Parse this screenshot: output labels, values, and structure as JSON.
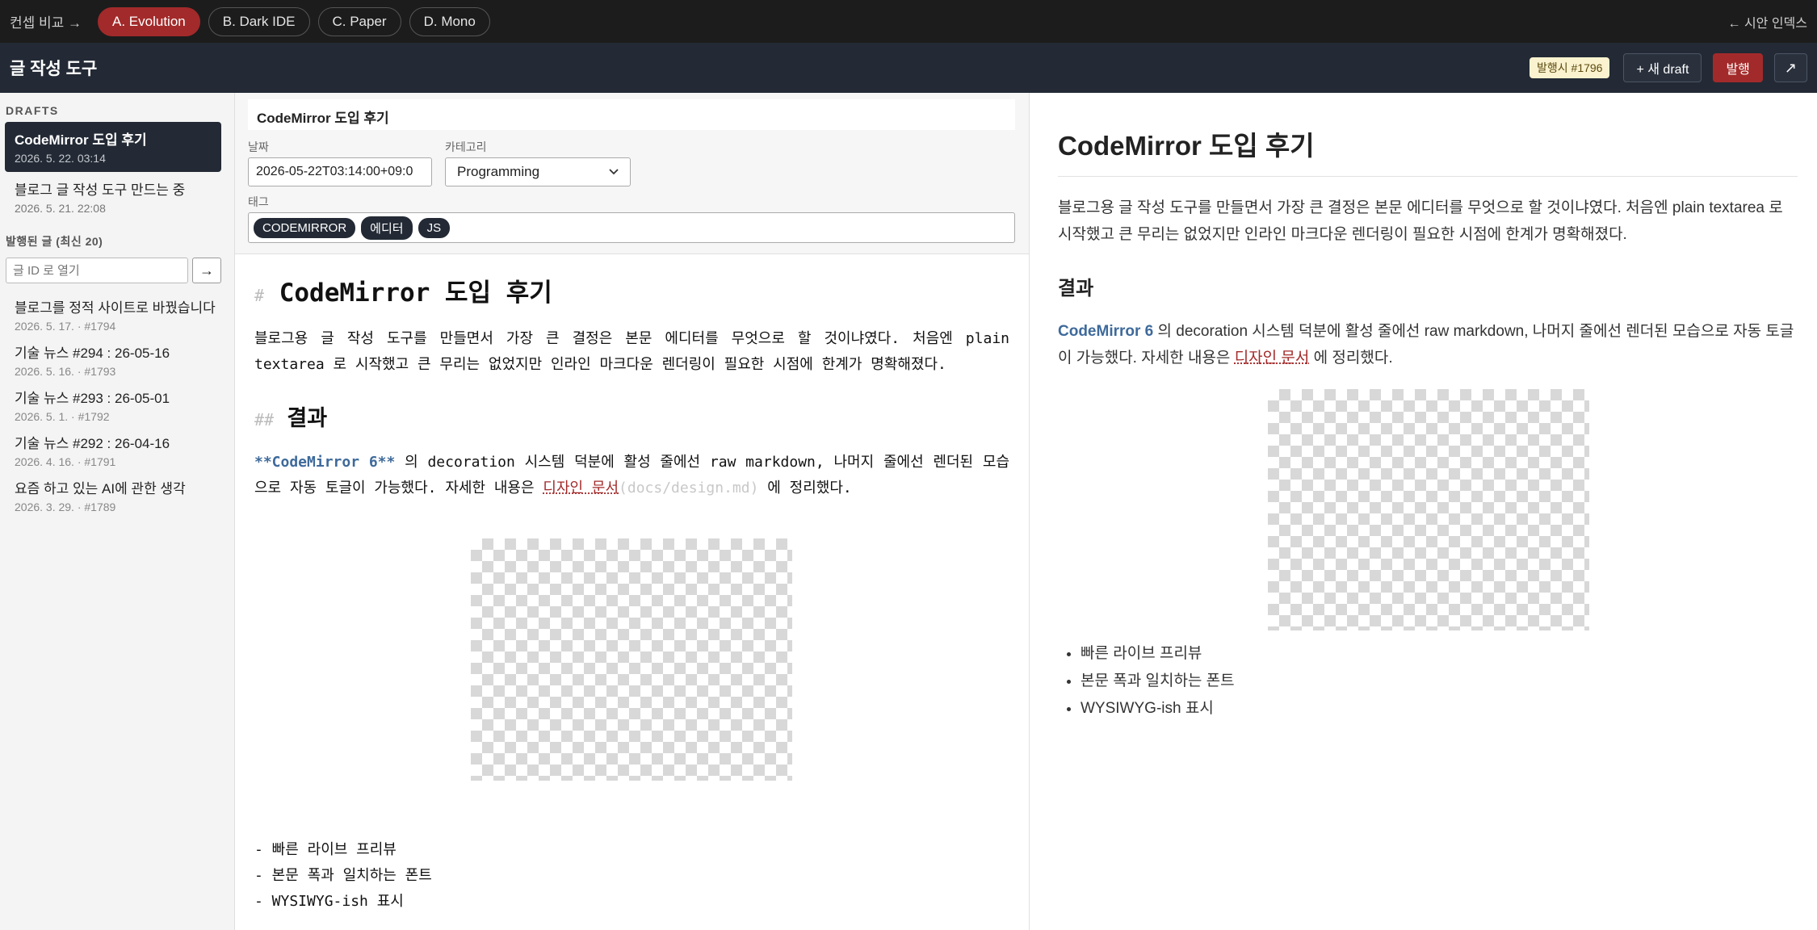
{
  "topbar": {
    "compare_label": "컨셉 비교 →",
    "concepts": [
      "A. Evolution",
      "B. Dark IDE",
      "C. Paper",
      "D. Mono"
    ],
    "index_link": "← 시안 인덱스"
  },
  "header": {
    "title": "글 작성 도구",
    "publish_badge": "발행시 #1796",
    "new_draft": "+ 새 draft",
    "publish": "발행",
    "expand": "↗"
  },
  "sidebar": {
    "drafts_label": "DRAFTS",
    "drafts": [
      {
        "title": "CodeMirror 도입 후기",
        "date": "2026. 5. 22. 03:14"
      },
      {
        "title": "블로그 글 작성 도구 만드는 중",
        "date": "2026. 5. 21. 22:08"
      }
    ],
    "published_label": "발행된 글 (최신 20)",
    "open_placeholder": "글 ID 로 열기",
    "open_button": "→",
    "published": [
      {
        "title": "블로그를 정적 사이트로 바꿨습니다",
        "meta": "2026. 5. 17. · #1794"
      },
      {
        "title": "기술 뉴스 #294 : 26-05-16",
        "meta": "2026. 5. 16. · #1793"
      },
      {
        "title": "기술 뉴스 #293 : 26-05-01",
        "meta": "2026. 5. 1. · #1792"
      },
      {
        "title": "기술 뉴스 #292 : 26-04-16",
        "meta": "2026. 4. 16. · #1791"
      },
      {
        "title": "요즘 하고 있는 AI에 관한 생각",
        "meta": "2026. 3. 29. · #1789"
      }
    ]
  },
  "editor": {
    "title_value": "CodeMirror 도입 후기",
    "date_label": "날짜",
    "date_value": "2026-05-22T03:14:00+09:0",
    "category_label": "카테고리",
    "category_value": "Programming",
    "tags_label": "태그",
    "tags": [
      "CODEMIRROR",
      "에디터",
      "JS"
    ],
    "source": {
      "h1_mark": "#",
      "h1": "CodeMirror 도입 후기",
      "para1": "블로그용 글 작성 도구를 만들면서 가장 큰 결정은 본문 에디터를 무엇으로 할 것이냐였다. 처음엔 plain textarea 로 시작했고 큰 무리는 없었지만 인라인 마크다운 렌더링이 필요한 시점에 한계가 명확해졌다.",
      "h2_mark": "##",
      "h2": "결과",
      "para2_bold": "**CodeMirror 6**",
      "para2_mid": " 의 decoration 시스템 덕분에 활성 줄에선 raw markdown, 나머지 줄에선 렌더된 모습으로 자동 토글이 가능했다. 자세한 내용은 ",
      "para2_link": "디자인 문서",
      "para2_url": "(docs/design.md)",
      "para2_end": " 에 정리했다.",
      "list": [
        "- 빠른 라이브 프리뷰",
        "- 본문 폭과 일치하는 폰트",
        "- WYSIWYG-ish 표시"
      ]
    }
  },
  "preview": {
    "h1": "CodeMirror 도입 후기",
    "para1": "블로그용 글 작성 도구를 만들면서 가장 큰 결정은 본문 에디터를 무엇으로 할 것이냐였다. 처음엔 plain textarea 로 시작했고 큰 무리는 없었지만 인라인 마크다운 렌더링이 필요한 시점에 한계가 명확해졌다.",
    "h2": "결과",
    "para2_bold": "CodeMirror 6",
    "para2_mid": " 의 decoration 시스템 덕분에 활성 줄에선 raw markdown, 나머지 줄에선 렌더된 모습으로 자동 토글이 가능했다. 자세한 내용은 ",
    "para2_link": "디자인 문서",
    "para2_end": " 에 정리했다.",
    "list": [
      "빠른 라이브 프리뷰",
      "본문 폭과 일치하는 폰트",
      "WYSIWYG-ish 표시"
    ]
  },
  "colors": {
    "accent": "#a32a2a",
    "header_bg": "#232a35",
    "topbar_bg": "#1c1c1c",
    "link_bold": "#3e6a9b"
  }
}
